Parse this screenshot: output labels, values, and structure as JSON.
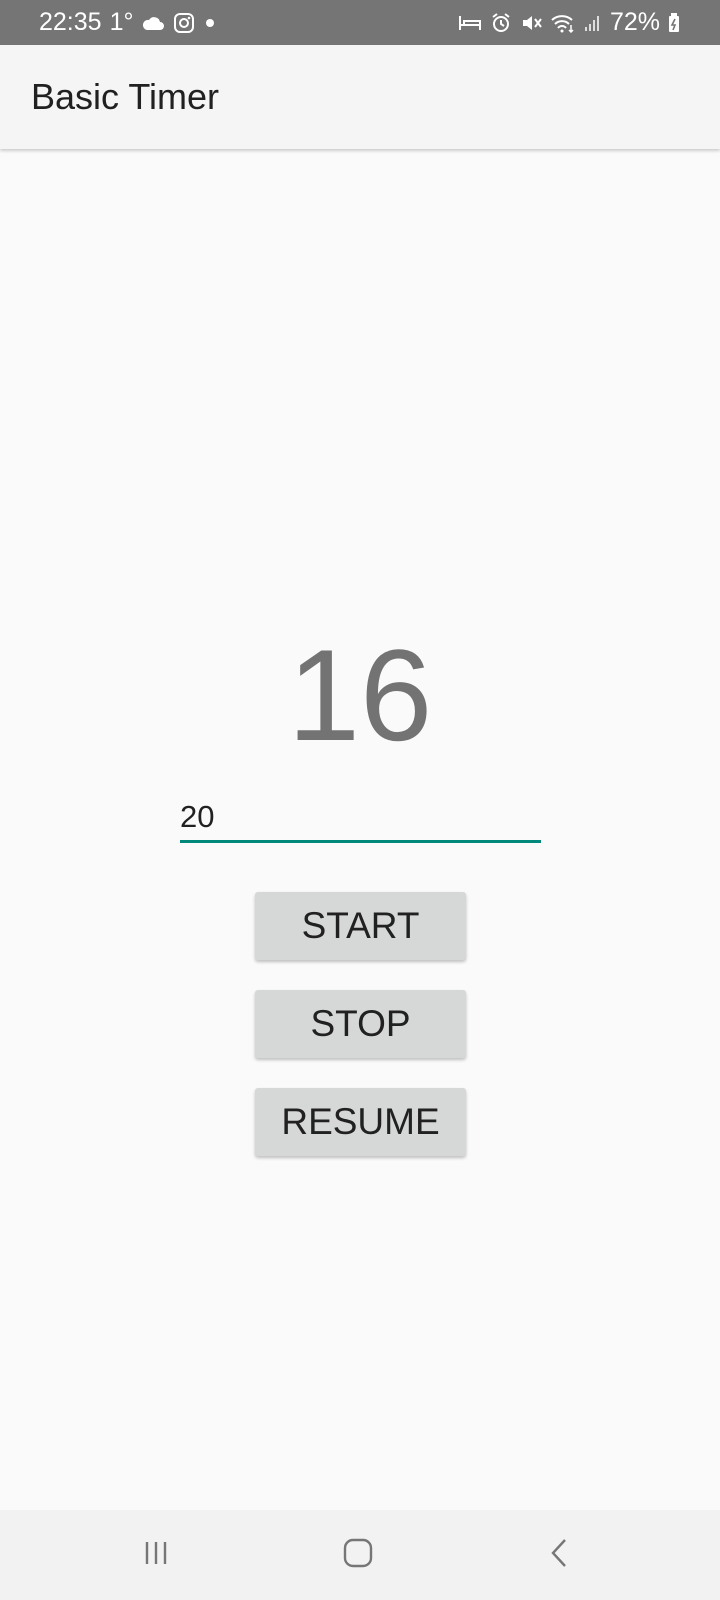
{
  "status_bar": {
    "time": "22:35",
    "temperature": "1°",
    "battery": "72%",
    "icons": [
      "cloud-icon",
      "instagram-icon",
      "notification-dot-icon",
      "sleep-mode-icon",
      "alarm-icon",
      "mute-icon",
      "wifi-icon",
      "signal-icon",
      "battery-icon"
    ]
  },
  "app_bar": {
    "title": "Basic Timer"
  },
  "timer": {
    "display_value": "16"
  },
  "input": {
    "value": "20"
  },
  "buttons": {
    "start_label": "START",
    "stop_label": "STOP",
    "resume_label": "RESUME"
  },
  "nav_bar": {
    "icons": [
      "recent-apps-icon",
      "home-icon",
      "back-icon"
    ]
  },
  "colors": {
    "status_bar_bg": "#757575",
    "app_bar_bg": "#f5f5f5",
    "accent": "#00897b",
    "button_bg": "#d6d7d7",
    "timer_text": "#737373"
  }
}
